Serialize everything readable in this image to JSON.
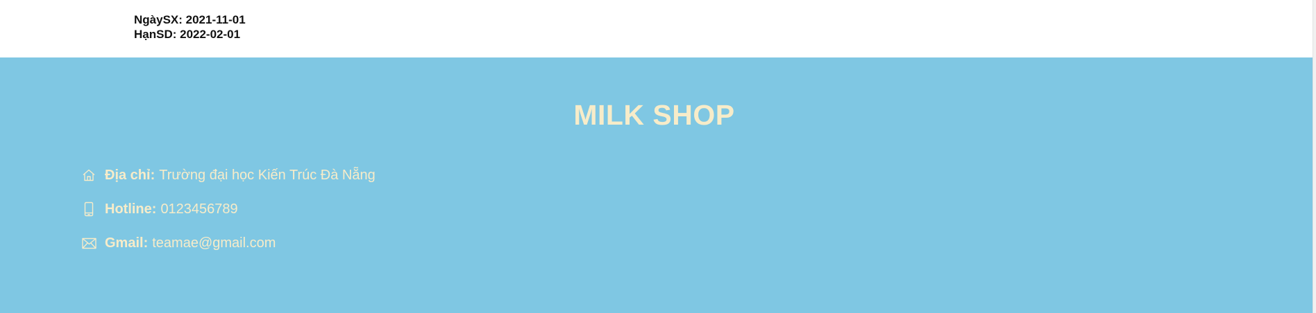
{
  "product": {
    "mfg_date": "NgàySX: 2021-11-01",
    "exp_date": "HạnSD: 2022-02-01"
  },
  "footer": {
    "shop_name": "MILK SHOP",
    "address_label": "Địa chỉ:",
    "address_value": "Trường đại học Kiến Trúc Đà Nẵng",
    "hotline_label": "Hotline:",
    "hotline_value": "0123456789",
    "gmail_label": "Gmail:",
    "gmail_value": "teamae@gmail.com",
    "icons": [
      "home-icon",
      "mobile-phone-icon",
      "envelope-icon"
    ]
  },
  "colors": {
    "footer_bg": "#7fc7e3",
    "footer_text": "#f7ecc9"
  }
}
